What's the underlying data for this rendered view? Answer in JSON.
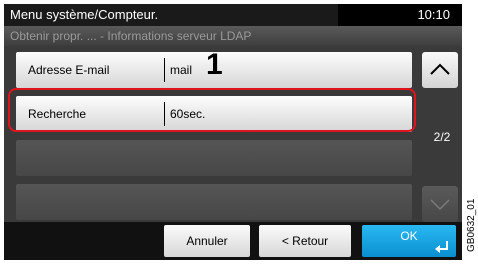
{
  "header": {
    "title": "Menu système/Compteur.",
    "time": "10:10",
    "breadcrumb": "Obtenir propr. ... - Informations serveur LDAP"
  },
  "list": {
    "items": [
      {
        "label": "Adresse E-mail",
        "value": "mail"
      },
      {
        "label": "Recherche",
        "value": "60sec."
      }
    ]
  },
  "callout_number": "1",
  "pager": {
    "page": "2/2"
  },
  "buttons": {
    "cancel": "Annuler",
    "back": "< Retour",
    "ok": "OK"
  },
  "figure_id": "GB0632_01",
  "colors": {
    "highlight": "#e0141e",
    "ok_button": "#1aa6e4",
    "title_bg": "#000000"
  },
  "icons": {
    "scroll_up": "chevron-up-icon",
    "scroll_down": "chevron-down-icon",
    "ok_enter": "enter-icon"
  }
}
